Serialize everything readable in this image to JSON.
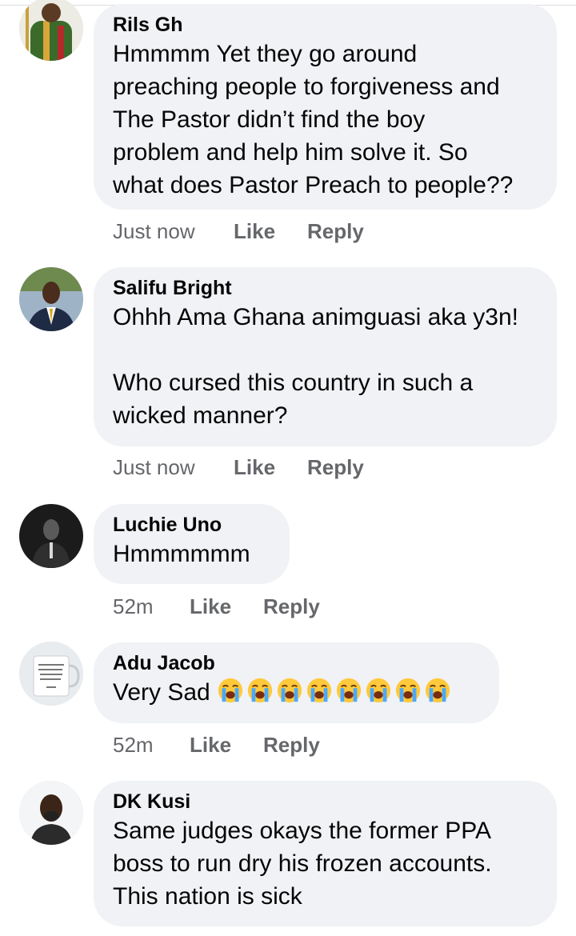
{
  "comments": [
    {
      "author": "Rils Gh",
      "text": "Hmmmm Yet they go around\npreaching people to forgiveness and\nThe Pastor didn’t find the boy\nproblem and help him solve it. So\nwhat does Pastor Preach to people??",
      "time": "Just now",
      "like": "Like",
      "reply": "Reply"
    },
    {
      "author": "Salifu Bright",
      "text": "Ohhh Ama Ghana animguasi aka y3n!\n\nWho cursed this country in such a\nwicked manner?",
      "time": "Just now",
      "like": "Like",
      "reply": "Reply"
    },
    {
      "author": "Luchie Uno",
      "text": "Hmmmmmm",
      "time": "52m",
      "like": "Like",
      "reply": "Reply"
    },
    {
      "author": "Adu Jacob",
      "text": "Very Sad",
      "emoji": "loudly-crying-face-icon",
      "emoji_count": 8,
      "time": "52m",
      "like": "Like",
      "reply": "Reply"
    },
    {
      "author": "DK Kusi",
      "text": "Same judges okays the former PPA\nboss to run dry his frozen accounts.\nThis nation is sick"
    }
  ],
  "colors": {
    "bubble": "#f0f2f5",
    "text": "#050505",
    "meta": "#65676b",
    "emoji_face": "#ffc93c",
    "emoji_tears": "#4aa8ff"
  }
}
